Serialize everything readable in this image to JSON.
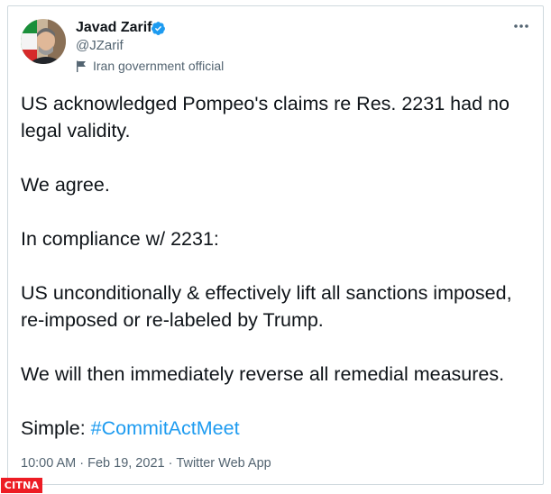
{
  "author": {
    "name": "Javad Zarif",
    "handle": "@JZarif",
    "label": "Iran government official"
  },
  "tweet": {
    "paragraphs": [
      "US acknowledged Pompeo's claims re Res. 2231 had no legal validity.",
      "We agree.",
      "In compliance w/ 2231:",
      "US unconditionally & effectively lift all sanctions imposed, re-imposed or re-labeled by Trump.",
      "We will then immediately reverse all remedial measures."
    ],
    "closing_prefix": "Simple: ",
    "hashtag": "#CommitActMeet"
  },
  "meta": {
    "time": "10:00 AM",
    "separator": "·",
    "date": "Feb 19, 2021",
    "source": "Twitter Web App"
  },
  "icons": {
    "verified": "verified-badge-icon",
    "label": "flag-icon",
    "more": "more-options-icon"
  },
  "colors": {
    "text": "#0f1419",
    "secondary": "#536471",
    "link": "#1d9bf0",
    "watermark": "#ed1c24"
  },
  "watermark": {
    "text": "CITNA"
  }
}
